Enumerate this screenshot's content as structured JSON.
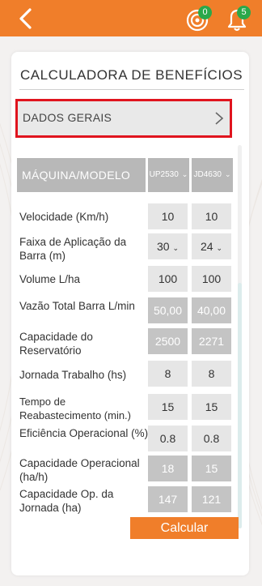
{
  "header": {
    "notifications": [
      {
        "icon": "target-icon",
        "count": "0"
      },
      {
        "icon": "bell-icon",
        "count": "5"
      }
    ],
    "colors": {
      "brand": "#f07e2a",
      "badge": "#2aa84a",
      "highlight": "#e0141e"
    }
  },
  "card": {
    "title": "CALCULADORA DE BENEFÍCIOS",
    "section": "DADOS GERAIS",
    "table_header": {
      "label": "MÁQUINA/MODELO",
      "model_a": "UP2530",
      "model_b": "JD4630"
    },
    "rows": [
      {
        "label": "Velocidade (Km/h)",
        "a": "10",
        "b": "10"
      },
      {
        "label": "Faixa de Aplicação da Barra (m)",
        "a": "30",
        "b": "24"
      },
      {
        "label": "Volume L/ha",
        "a": "100",
        "b": "100"
      },
      {
        "label": "Vazão Total Barra L/min",
        "a": "50,00",
        "b": "40,00"
      },
      {
        "label": "Capacidade do Reservatório",
        "a": "2500",
        "b": "2271"
      },
      {
        "label": "Jornada Trabalho (hs)",
        "a": "8",
        "b": "8"
      },
      {
        "label": "Tempo de Reabastecimento (min.)",
        "a": "15",
        "b": "15"
      },
      {
        "label": "Eficiência Operacional (%)",
        "a": "0.8",
        "b": "0.8"
      },
      {
        "label": "Capacidade Operacional (ha/h)",
        "a": "18",
        "b": "15"
      },
      {
        "label": "Capacidade Op. da Jornada (ha)",
        "a": "147",
        "b": "121"
      }
    ],
    "calculate_label": "Calcular"
  }
}
